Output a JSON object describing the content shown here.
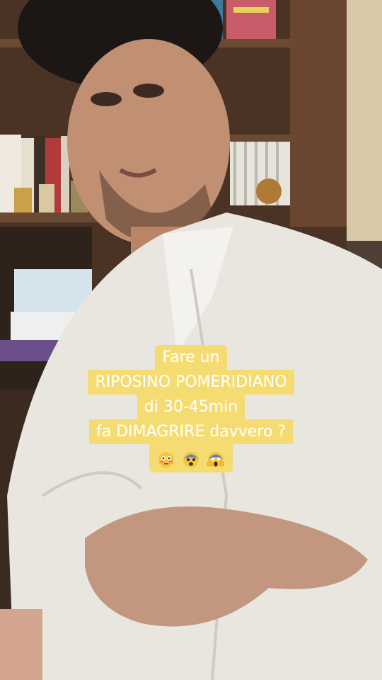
{
  "caption": {
    "line1": "Fare un",
    "line2": "RIPOSINO POMERIDIANO",
    "line3": "di 30-45min",
    "line4": "fa DIMAGRIRE davvero ?"
  },
  "emojis": [
    "flushed-face-icon",
    "fearful-face-icon",
    "screaming-face-icon"
  ],
  "colors": {
    "caption_bg": "#f5dc72",
    "caption_text": "#ffffff"
  }
}
